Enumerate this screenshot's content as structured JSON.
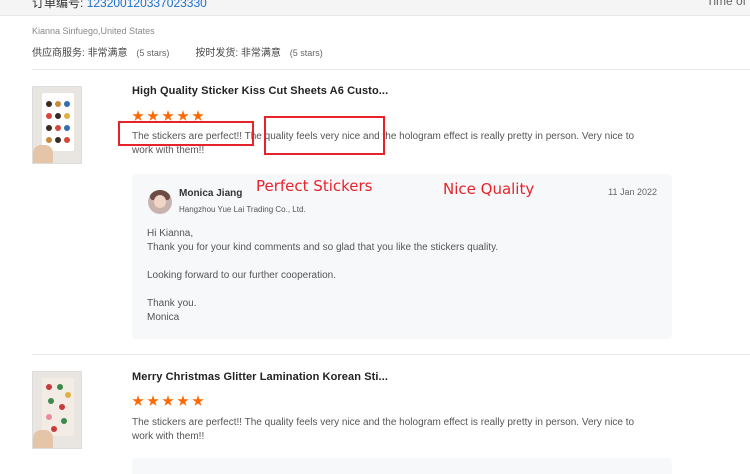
{
  "header": {
    "order_label": "订单编号:",
    "order_number": "123200120337023330",
    "time_label": "Time of"
  },
  "buyer": "Kianna Sinfuego,United States",
  "seller_ratings": [
    {
      "label": "供应商服务:",
      "value": "非常满意",
      "note": "(5 stars)"
    },
    {
      "label": "按时发货:",
      "value": "非常满意",
      "note": "(5 stars)"
    }
  ],
  "reviews": [
    {
      "title": "High Quality Sticker Kiss Cut Sheets A6 Custo...",
      "rating": 5,
      "text": "The stickers are perfect!! The quality feels very nice and the hologram effect is really pretty in person. Very nice to work with them!!",
      "reply": {
        "name": "Monica Jiang",
        "company": "Hangzhou Yue Lai Trading Co., Ltd.",
        "date": "11 Jan 2022",
        "greeting": "Hi Kianna,",
        "line1": "Thank you for your kind comments and so glad that you like the stickers quality.",
        "line2": "Looking forward to our further cooperation.",
        "closing": "Thank you.",
        "signature": "Monica"
      }
    },
    {
      "title": "Merry Christmas Glitter Lamination Korean Sti...",
      "rating": 5,
      "text": "The stickers are perfect!! The quality feels very nice and the hologram effect is really pretty in person. Very nice to work with them!!"
    }
  ],
  "annotations": {
    "perfect_stickers": "Perfect Stickers",
    "nice_quality": "Nice Quality"
  },
  "colors": {
    "accent_orange": "#ff6a00",
    "annotation_red": "#e8222a",
    "link_blue": "#1a6dd1"
  }
}
